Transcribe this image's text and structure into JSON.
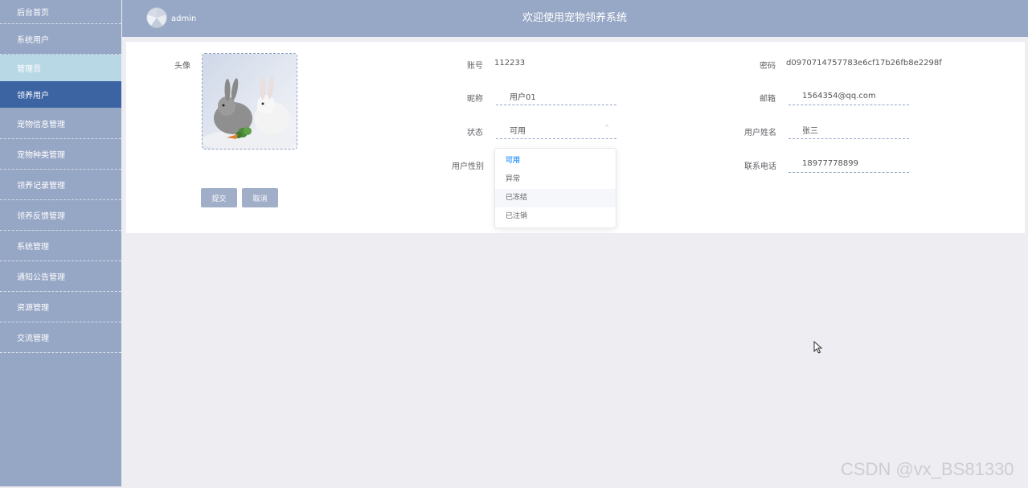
{
  "sidebar": {
    "items": [
      {
        "label": "后台首页"
      },
      {
        "label": "系统用户"
      },
      {
        "label": "管理员"
      },
      {
        "label": "领养用户"
      },
      {
        "label": "宠物信息管理"
      },
      {
        "label": "宠物种类管理"
      },
      {
        "label": "领养记录管理"
      },
      {
        "label": "领养反馈管理"
      },
      {
        "label": "系统管理"
      },
      {
        "label": "通知公告管理"
      },
      {
        "label": "资源管理"
      },
      {
        "label": "交流管理"
      }
    ]
  },
  "header": {
    "user": "admin",
    "title": "欢迎使用宠物领养系统"
  },
  "form": {
    "avatar_label": "头像",
    "account_label": "账号",
    "account_value": "112233",
    "password_label": "密码",
    "password_value": "d0970714757783e6cf17b26fb8e2298f",
    "nickname_label": "昵称",
    "nickname_value": "用户01",
    "email_label": "邮箱",
    "email_value": "1564354@qq.com",
    "status_label": "状态",
    "status_value": "可用",
    "realname_label": "用户姓名",
    "realname_value": "张三",
    "gender_label": "用户性别",
    "phone_label": "联系电话",
    "phone_value": "18977778899",
    "submit_label": "提交",
    "cancel_label": "取消"
  },
  "status_dropdown": {
    "options": [
      {
        "label": "可用"
      },
      {
        "label": "异常"
      },
      {
        "label": "已冻结"
      },
      {
        "label": "已注销"
      }
    ]
  },
  "watermark": "CSDN @vx_BS81330",
  "colors": {
    "sidebar_bg": "#96a6c5",
    "sidebar_active": "#3c64a2",
    "sidebar_light": "#b8d8e6",
    "header_bg": "#97a8c6",
    "button_bg": "#a1aec8",
    "selected_option": "#409eff"
  }
}
